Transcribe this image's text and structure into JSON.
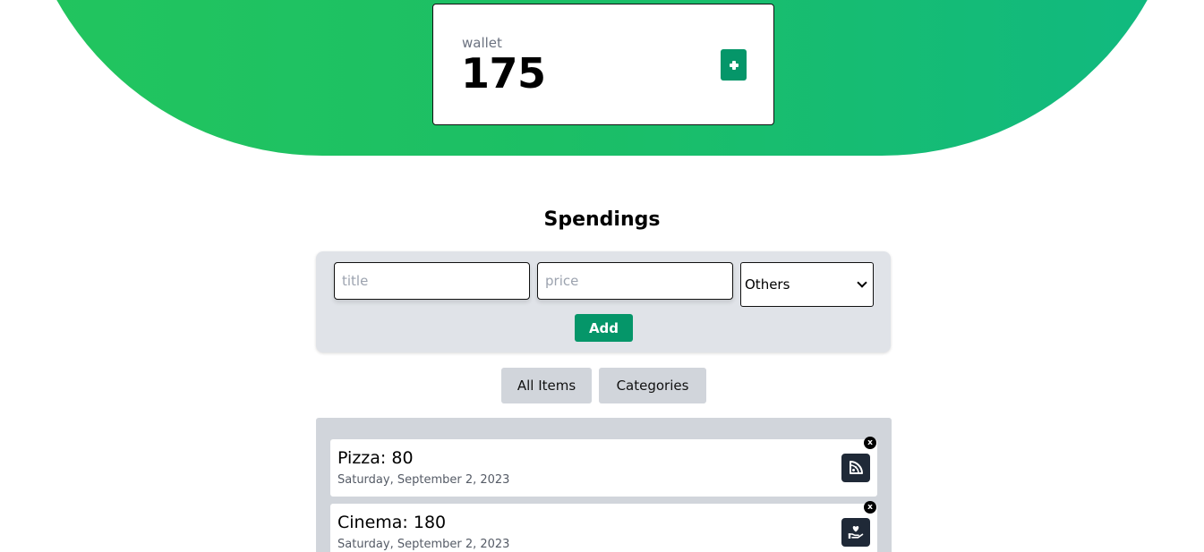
{
  "wallet": {
    "label": "wallet",
    "amount": "175",
    "add_icon": "plus-icon"
  },
  "spendings": {
    "title": "Spendings",
    "form": {
      "title_placeholder": "title",
      "price_placeholder": "price",
      "category_selected": "Others",
      "add_label": "Add"
    },
    "tabs": [
      {
        "label": "All Items"
      },
      {
        "label": "Categories"
      }
    ],
    "items": [
      {
        "title": "Pizza: 80",
        "date": "Saturday, September 2, 2023",
        "icon": "pizza-slice-icon",
        "close_label": "x"
      },
      {
        "title": "Cinema: 180",
        "date": "Saturday, September 2, 2023",
        "icon": "hand-holding-heart-icon",
        "close_label": "x"
      }
    ]
  },
  "colors": {
    "hero_gradient_start": "#22c55e",
    "hero_gradient_end": "#10b981",
    "accent_button": "#059669",
    "icon_tile": "#1f2937",
    "panel_bg": "#e0e3e8",
    "list_bg": "#d1d5db"
  }
}
